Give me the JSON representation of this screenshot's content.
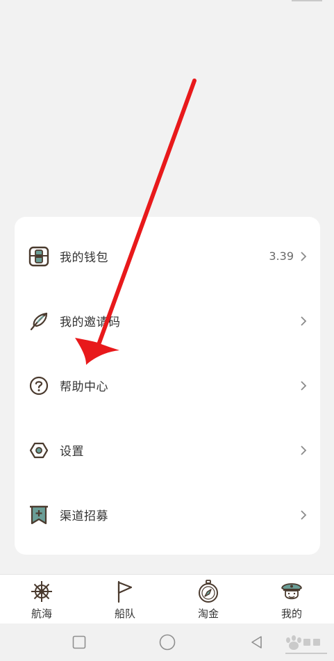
{
  "menu": {
    "items": [
      {
        "label": "我的钱包",
        "value": "3.39",
        "icon": "wallet-icon"
      },
      {
        "label": "我的邀请码",
        "value": "",
        "icon": "feather-icon"
      },
      {
        "label": "帮助中心",
        "value": "",
        "icon": "help-circle-icon"
      },
      {
        "label": "设置",
        "value": "",
        "icon": "settings-hexagon-icon"
      },
      {
        "label": "渠道招募",
        "value": "",
        "icon": "bookmark-plus-icon"
      }
    ]
  },
  "tabbar": {
    "tabs": [
      {
        "label": "航海",
        "icon": "ship-wheel-icon"
      },
      {
        "label": "船队",
        "icon": "flag-icon"
      },
      {
        "label": "淘金",
        "icon": "compass-icon"
      },
      {
        "label": "我的",
        "icon": "captain-avatar-icon"
      }
    ]
  },
  "colors": {
    "accent_teal": "#6b9e97",
    "icon_brown": "#4a3a2e",
    "annotation_arrow": "#e8191b"
  }
}
